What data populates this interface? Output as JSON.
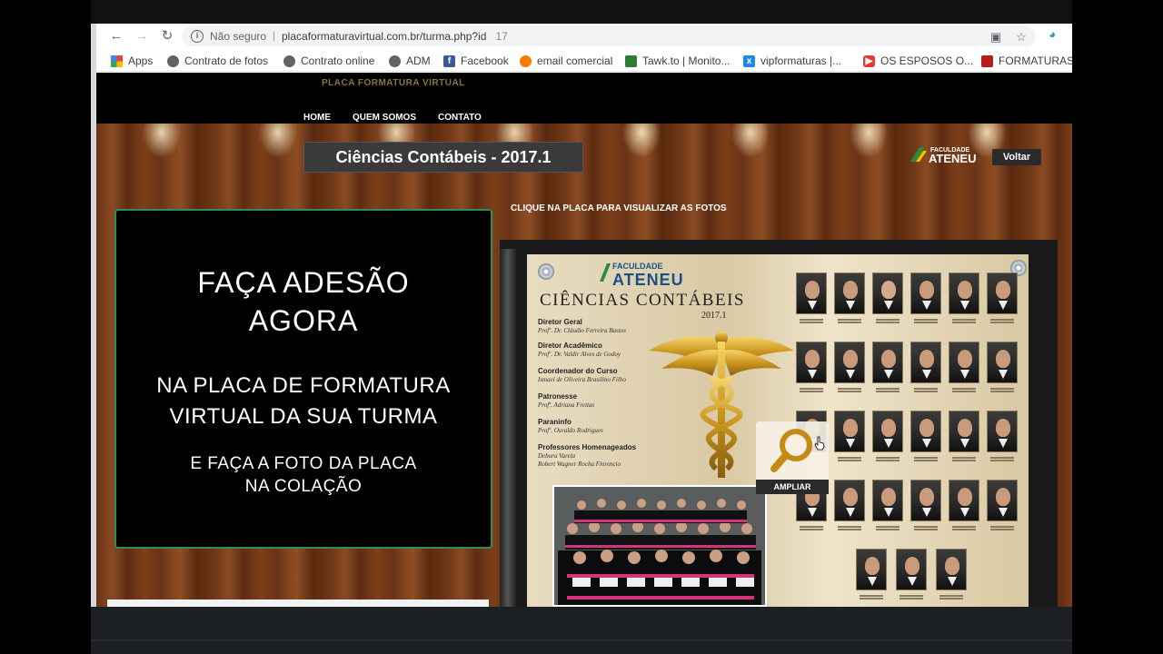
{
  "browser": {
    "not_secure": "Não seguro",
    "url_main": "placaformaturavirtual.com.br/turma.php?id",
    "url_tail": "17",
    "bookmarks": [
      {
        "label": "Apps",
        "icon": "apps-grid-icon"
      },
      {
        "label": "Contrato de fotos",
        "icon": "globe-icon"
      },
      {
        "label": "Contrato online",
        "icon": "globe-icon"
      },
      {
        "label": "ADM",
        "icon": "globe-icon"
      },
      {
        "label": "Facebook",
        "icon": "facebook-icon"
      },
      {
        "label": "email comercial",
        "icon": "mail-icon"
      },
      {
        "label": "Tawk.to | Monito...",
        "icon": "tawk-icon"
      },
      {
        "label": "vipformaturas |...",
        "icon": "vip-icon"
      },
      {
        "label": "OS ESPOSOS O...",
        "icon": "youtube-icon"
      },
      {
        "label": "FORMATURAS",
        "icon": "bat-icon"
      }
    ]
  },
  "site": {
    "logo_text": "PLACA FORMATURA VIRTUAL",
    "menu": [
      "HOME",
      "QUEM SOMOS",
      "CONTATO"
    ],
    "course_title": "Ciências Contábeis - 2017.1",
    "partner_logo": {
      "small": "FACULDADE",
      "big": "ATENEU"
    },
    "back_button": "Voltar",
    "instruction": "CLIQUE NA PLACA PARA VISUALIZAR AS FOTOS",
    "promo": {
      "line1": "FAÇA ADESÃO",
      "line2": "AGORA",
      "line3": "NA PLACA DE FORMATURA",
      "line4": "VIRTUAL DA SUA TURMA",
      "line5": "E FAÇA A FOTO DA PLACA",
      "line6": "NA COLAÇÃO"
    },
    "plaque": {
      "logo_small": "FACULDADE",
      "logo_big": "ATENEU",
      "title": "CIÊNCIAS CONTÁBEIS",
      "year": "2017.1",
      "roles": [
        {
          "role": "Diretor Geral",
          "name": "Profº. Dr. Cláudio Ferreira Bastos"
        },
        {
          "role": "Diretor Acadêmico",
          "name": "Profº. Dr. Valdir Alves de Godoy"
        },
        {
          "role": "Coordenador do Curso",
          "name": "Ismael de Oliveira Brasilino Filho"
        },
        {
          "role": "Patronesse",
          "name": "Profª. Adriana Freitas"
        },
        {
          "role": "Paraninfo",
          "name": "Profº. Osvaldo Rodrigues"
        },
        {
          "role": "Professores Homenageados",
          "name": "Debora Varela"
        },
        {
          "role": "",
          "name": "Robert Wagner Rocha Florencio"
        }
      ],
      "zoom_label": "AMPLIAR"
    }
  }
}
